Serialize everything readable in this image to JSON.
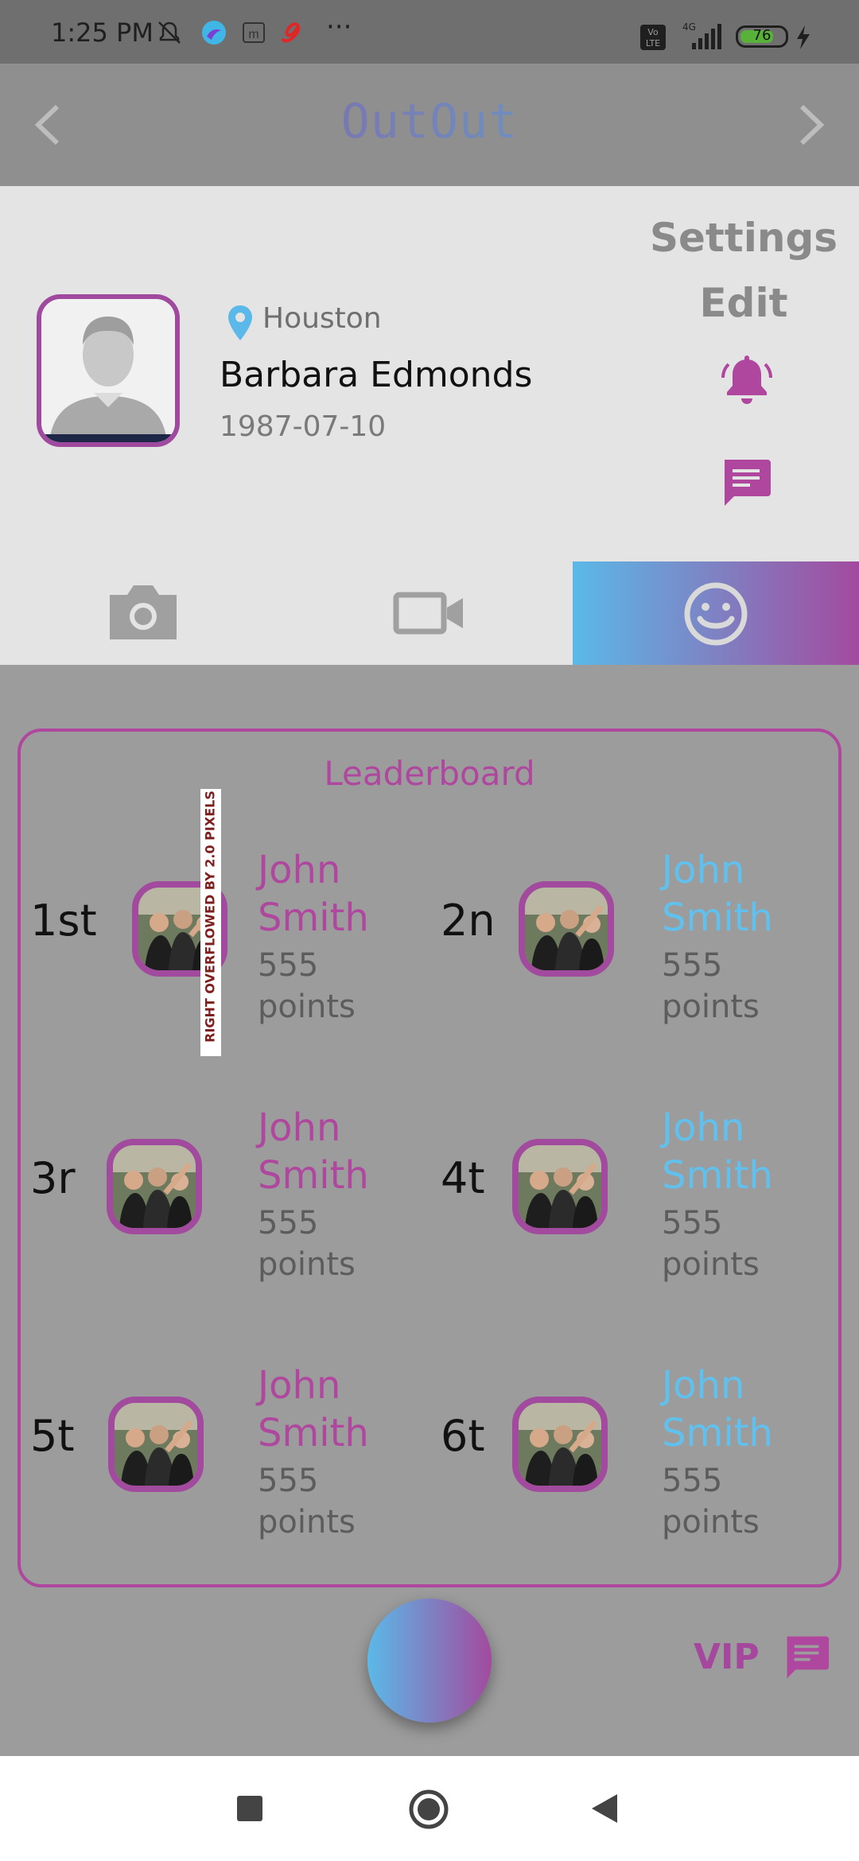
{
  "status_bar": {
    "time": "1:25 PM",
    "more": "···",
    "battery_level": "76",
    "battery_fraction": 0.76,
    "icons": [
      "mute-icon",
      "app-icon",
      "m-icon",
      "airtel-icon",
      "volte-icon",
      "4g-signal-icon",
      "charging-icon"
    ]
  },
  "app_bar": {
    "title": "OutOut",
    "back_icon": "chevron-left-icon",
    "forward_icon": "chevron-right-icon"
  },
  "profile": {
    "location": "Houston",
    "name": "Barbara Edmonds",
    "dob": "1987-07-10",
    "settings_label": "Settings",
    "edit_label": "Edit"
  },
  "tabs": [
    {
      "icon": "camera-icon",
      "active": false
    },
    {
      "icon": "video-icon",
      "active": false
    },
    {
      "icon": "smiley-icon",
      "active": true
    }
  ],
  "leaderboard": {
    "title": "Leaderboard",
    "overflow_notice": "RIGHT OVERFLOWED BY 2.0 PIXELS",
    "entries": [
      {
        "rank": "1st",
        "first": "John",
        "last": "Smith",
        "points": "555",
        "points_label": "points"
      },
      {
        "rank": "2n",
        "first": "John",
        "last": "Smith",
        "points": "555",
        "points_label": "points"
      },
      {
        "rank": "3r",
        "first": "John",
        "last": "Smith",
        "points": "555",
        "points_label": "points"
      },
      {
        "rank": "4t",
        "first": "John",
        "last": "Smith",
        "points": "555",
        "points_label": "points"
      },
      {
        "rank": "5t",
        "first": "John",
        "last": "Smith",
        "points": "555",
        "points_label": "points"
      },
      {
        "rank": "6t",
        "first": "John",
        "last": "Smith",
        "points": "555",
        "points_label": "points"
      }
    ]
  },
  "bottom": {
    "vip_label": "VIP"
  },
  "colors": {
    "accent_pink": "#b0479f",
    "accent_blue": "#61c1ee"
  }
}
